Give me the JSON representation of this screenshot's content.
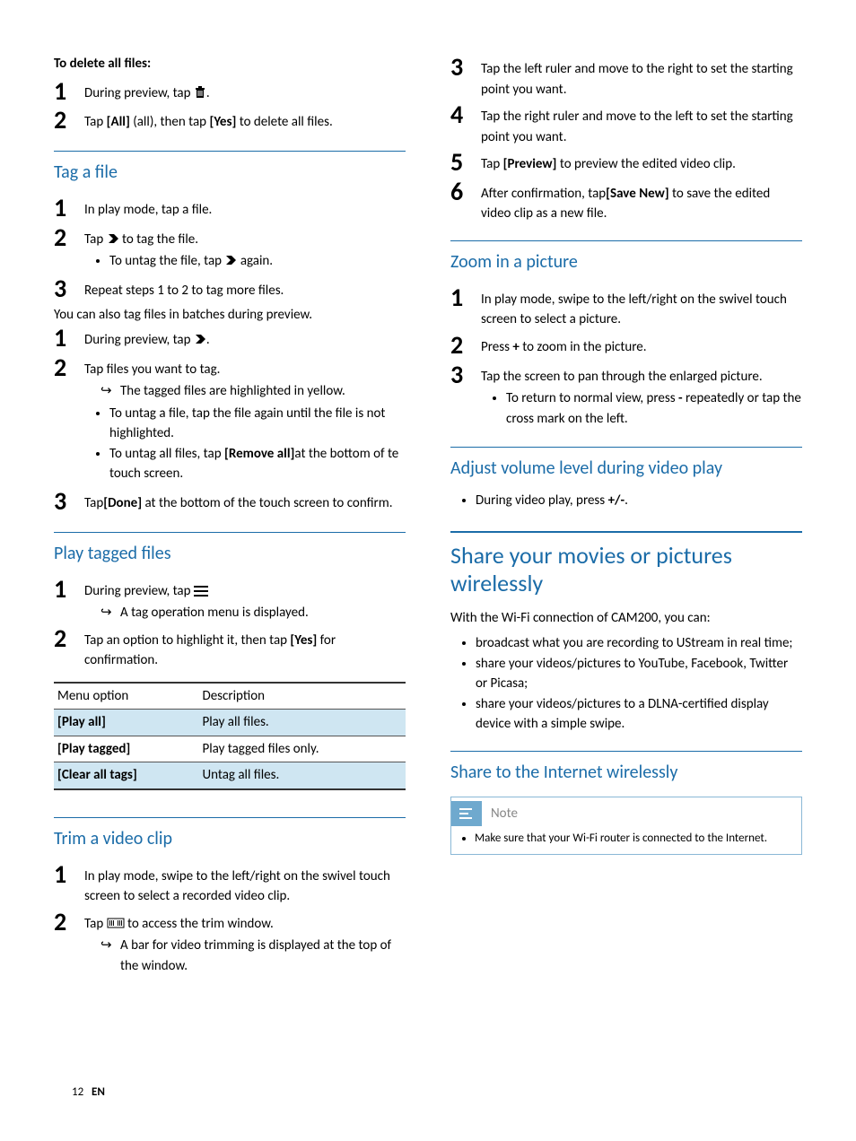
{
  "left": {
    "delete_heading": "To delete all files:",
    "del1": "During preview, tap ",
    "del1b": ".",
    "del2a": "Tap ",
    "del2b": "[All]",
    "del2c": " (all), then tap ",
    "del2d": "[Yes]",
    "del2e": " to delete all files.",
    "tagfile_h": "Tag a file",
    "tag1": "In play mode, tap a file.",
    "tag2a": "Tap ",
    "tag2b": " to tag the file.",
    "tag2_bullet_a": "To untag the file, tap ",
    "tag2_bullet_b": " again.",
    "tag3": "Repeat steps 1 to 2 to tag more files.",
    "tag_batch": "You can also tag files in batches during preview.",
    "batch1a": "During preview, tap ",
    "batch1b": ".",
    "batch2": "Tap files you want to tag.",
    "batch2_arrow": "The tagged files are highlighted in yellow.",
    "batch2_b1": "To untag a file, tap the file again until the file is not highlighted.",
    "batch2_b2a": "To untag all files, tap ",
    "batch2_b2b": "[Remove all]",
    "batch2_b2c": "at the bottom of te touch screen.",
    "batch3a": "Tap",
    "batch3b": "[Done]",
    "batch3c": " at the bottom of the touch screen to confirm.",
    "play_h": "Play tagged files",
    "play1": "During preview, tap ",
    "play1_arrow": "A tag operation menu is displayed.",
    "play2a": "Tap an option to highlight it, then tap ",
    "play2b": "[Yes]",
    "play2c": " for confirmation.",
    "table": {
      "h1": "Menu option",
      "h2": "Description",
      "rows": [
        {
          "opt": "[Play all]",
          "desc": "Play all files."
        },
        {
          "opt": "[Play tagged]",
          "desc": "Play tagged files only."
        },
        {
          "opt": "[Clear all tags]",
          "desc": "Untag all files."
        }
      ]
    },
    "trim_h": "Trim a video clip",
    "trim1": "In play mode, swipe to the left/right on the swivel touch screen to select a recorded video clip.",
    "trim2a": "Tap ",
    "trim2b": " to access the trim window.",
    "trim2_arrow": "A bar for video trimming is displayed at the top of the window."
  },
  "right": {
    "trim3": "Tap the left ruler and move to the right to set the starting point you want.",
    "trim4": "Tap the right ruler and move to the left to set the starting point you want.",
    "trim5a": "Tap ",
    "trim5b": "[Preview]",
    "trim5c": " to preview the edited video clip.",
    "trim6a": "After confirmation, tap",
    "trim6b": "[Save New]",
    "trim6c": " to save the edited video clip as a new file.",
    "zoom_h": "Zoom in a picture",
    "zoom1": "In play mode, swipe to the left/right on the swivel touch screen to select a picture.",
    "zoom2a": "Press ",
    "zoom2b": "+",
    "zoom2c": " to zoom in the picture.",
    "zoom3": "Tap the screen to pan through the enlarged picture.",
    "zoom3_b_a": "To return to normal view, press ",
    "zoom3_b_b": "-",
    "zoom3_b_c": " repeatedly or tap the cross mark on the left.",
    "vol_h": "Adjust volume level during video play",
    "vol_b_a": "During video play, press ",
    "vol_b_b": "+/-",
    "vol_b_c": ".",
    "share_h": "Share your movies or pictures wirelessly",
    "share_p": "With the Wi-Fi connection of CAM200, you can:",
    "share_li1": "broadcast what you are recording to UStream in real time;",
    "share_li2": "share your videos/pictures to YouTube, Facebook, Twitter or Picasa;",
    "share_li3": "share your videos/pictures to a DLNA-certified display device with a simple swipe.",
    "share_internet_h": "Share to the Internet wirelessly",
    "note_label": "Note",
    "note_text": "Make sure that your Wi-Fi router is connected to the Internet."
  },
  "footer": {
    "page": "12",
    "lang": "EN"
  }
}
